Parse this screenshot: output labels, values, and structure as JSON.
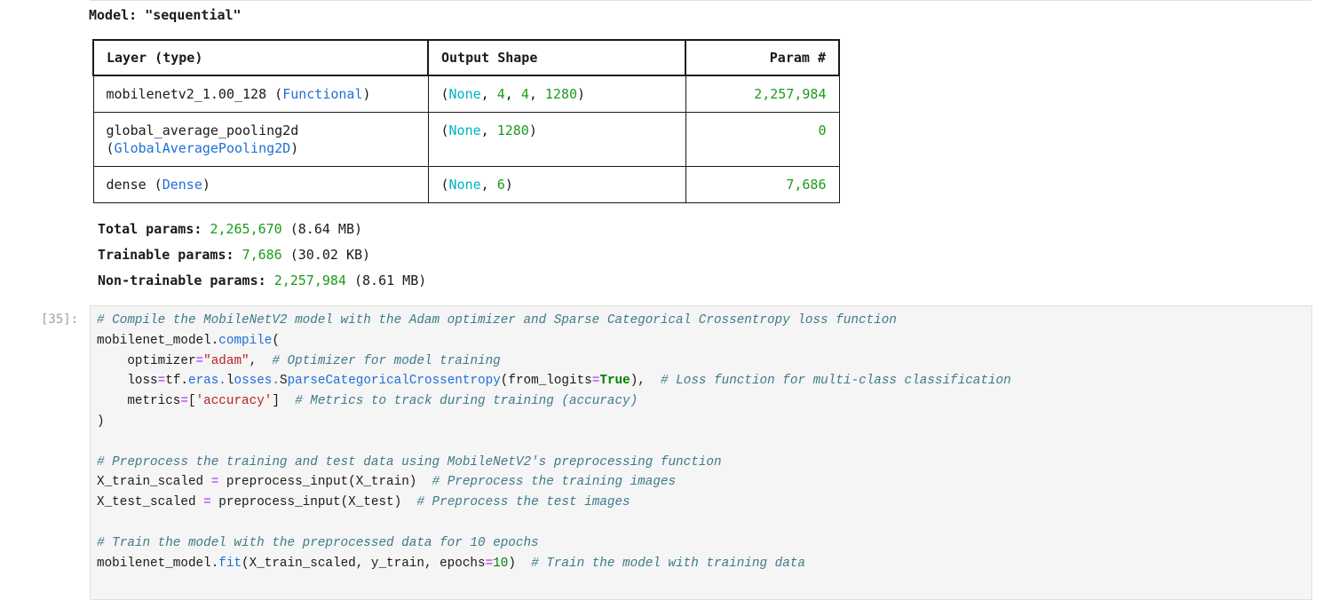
{
  "model_title": "Model: \"sequential\"",
  "table": {
    "headers": [
      "Layer (type)",
      "Output Shape",
      "Param #"
    ],
    "rows": [
      {
        "layer_name": "mobilenetv2_1.00_128",
        "layer_type": "Functional",
        "shape_parts": [
          "None",
          "4",
          "4",
          "1280"
        ],
        "params": "2,257,984"
      },
      {
        "layer_name": "global_average_pooling2d",
        "layer_type": "GlobalAveragePooling2D",
        "shape_parts": [
          "None",
          "1280"
        ],
        "params": "0"
      },
      {
        "layer_name": "dense",
        "layer_type": "Dense",
        "shape_parts": [
          "None",
          "6"
        ],
        "params": "7,686"
      }
    ]
  },
  "params": {
    "total_label": "Total params:",
    "total_value": "2,265,670",
    "total_size": "(8.64 MB)",
    "trainable_label": "Trainable params:",
    "trainable_value": "7,686",
    "trainable_size": "(30.02 KB)",
    "nontrainable_label": "Non-trainable params:",
    "nontrainable_value": "2,257,984",
    "nontrainable_size": "(8.61 MB)"
  },
  "cell": {
    "prompt": "[35]:",
    "lines": [
      "# Compile the MobileNetV2 model with the Adam optimizer and Sparse Categorical Crossentropy loss function",
      "mobilenet_model.compile(",
      "    optimizer=\"adam\",  # Optimizer for model training",
      "    loss=tf.keras.losses.SparseCategoricalCrossentropy(from_logits=True),  # Loss function for multi-class classification",
      "    metrics=['accuracy']  # Metrics to track during training (accuracy)",
      ")",
      "",
      "# Preprocess the training and test data using MobileNetV2's preprocessing function",
      "X_train_scaled = preprocess_input(X_train)  # Preprocess the training images",
      "X_test_scaled = preprocess_input(X_test)  # Preprocess the test images",
      "",
      "# Train the model with the preprocessed data for 10 epochs",
      "mobilenet_model.fit(X_train_scaled, y_train, epochs=10)  # Train the model with training data"
    ]
  },
  "colors": {
    "comment": "#3d7a8a",
    "string": "#ba2121",
    "attribute": "#1e6fd9",
    "operator": "#aa22ff",
    "number": "#008000",
    "layer_type": "#1e6fd9",
    "none_keyword": "#00b3c7",
    "param_number": "#1a9c1a",
    "cell_background": "#f5f5f5"
  }
}
